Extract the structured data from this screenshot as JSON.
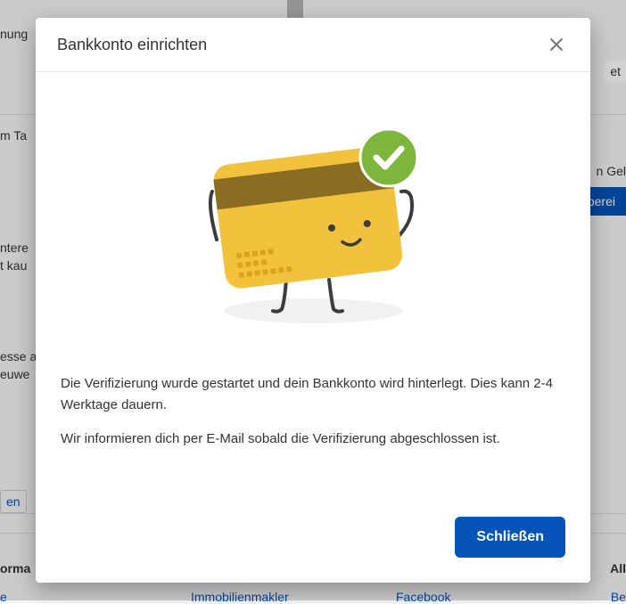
{
  "background": {
    "line_top": "nung",
    "tag_label": "m Ta",
    "interest1": "ntere",
    "interest2": "t kau",
    "address1": "esse a",
    "address2": "euwe",
    "bottom_link": "en",
    "info_label": "orma",
    "footer_link1": "Immobilienmakler",
    "footer_link2": "Facebook",
    "right_tab": "et",
    "right_gel": "n Gel",
    "right_btn": "berei",
    "right_all": "All",
    "right_be": "Be",
    "left_e": "e"
  },
  "modal": {
    "title": "Bankkonto einrichten",
    "message1": "Die Verifizierung wurde gestartet und dein Bankkonto wird hinterlegt. Dies kann 2-4 Werktage dauern.",
    "message2": "Wir informieren dich per E-Mail sobald die Verifizierung abgeschlossen ist.",
    "close_button": "Schließen"
  }
}
